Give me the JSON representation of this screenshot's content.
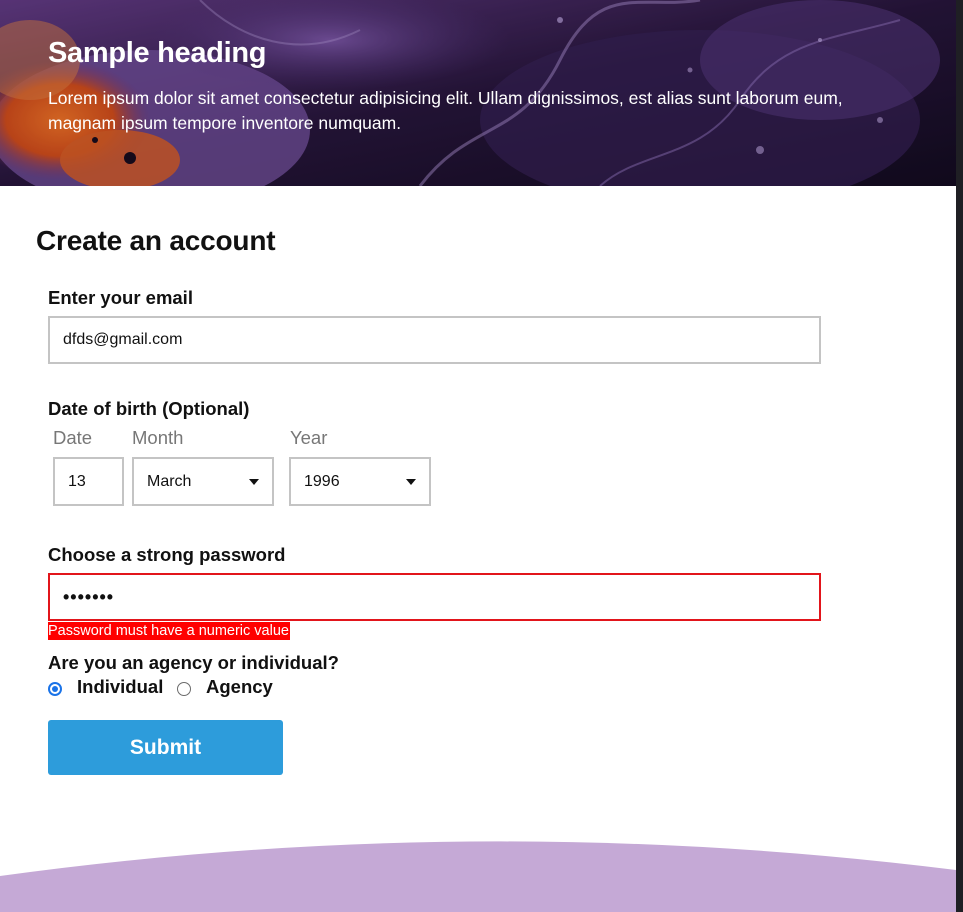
{
  "hero": {
    "heading": "Sample heading",
    "text": "Lorem ipsum dolor sit amet consectetur adipisicing elit. Ullam dignissimos, est alias sunt laborum eum, magnam ipsum tempore inventore numquam."
  },
  "form": {
    "title": "Create an account",
    "email": {
      "label": "Enter your email",
      "value": "dfds@gmail.com"
    },
    "dob": {
      "label": "Date of birth (Optional)",
      "date_label": "Date",
      "month_label": "Month",
      "year_label": "Year",
      "date_value": "13",
      "month_value": "March",
      "year_value": "1996"
    },
    "password": {
      "label": "Choose a strong password",
      "value": "•••••••",
      "error": "Password must have a numeric value"
    },
    "account_type": {
      "label": "Are you an agency or individual?",
      "options": [
        "Individual",
        "Agency"
      ],
      "selected": "Individual"
    },
    "submit_label": "Submit"
  },
  "colors": {
    "accent": "#2d9cdb",
    "error": "#ff0000",
    "radio_selected": "#1a73e8",
    "footer_wave": "#c5a9d6",
    "hero_dark": "#241638",
    "hero_orange": "#e8632a"
  }
}
